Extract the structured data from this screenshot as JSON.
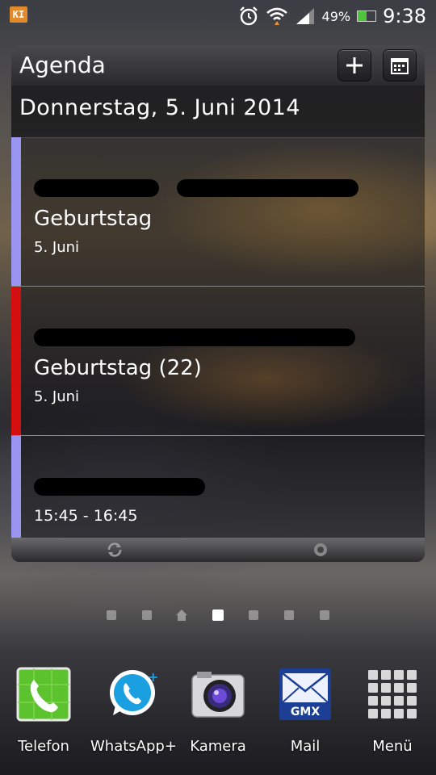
{
  "status_bar": {
    "notification": "KI",
    "battery_percent": "49%",
    "battery_level": 0.49,
    "time": "9:38"
  },
  "widget": {
    "title": "Agenda",
    "date": "Donnerstag, 5. Juni 2014",
    "events": [
      {
        "title": "Geburtstag",
        "subtitle": "5. Juni",
        "color": "#9a95f0"
      },
      {
        "title": "Geburtstag (22)",
        "subtitle": "5. Juni",
        "color": "#d40f0f"
      },
      {
        "title": "",
        "subtitle": "15:45 - 16:45",
        "color": "#9a95f0"
      }
    ]
  },
  "home_pages": {
    "count": 7,
    "active_index": 3
  },
  "dock": [
    {
      "label": "Telefon",
      "icon": "phone-icon"
    },
    {
      "label": "WhatsApp+",
      "icon": "whatsapp-icon"
    },
    {
      "label": "Kamera",
      "icon": "camera-icon"
    },
    {
      "label": "Mail",
      "icon": "mail-icon"
    },
    {
      "label": "Menü",
      "icon": "apps-grid-icon"
    }
  ],
  "colors": {
    "battery_fill": "#4ec43b",
    "kies_badge": "#e28a2b"
  }
}
